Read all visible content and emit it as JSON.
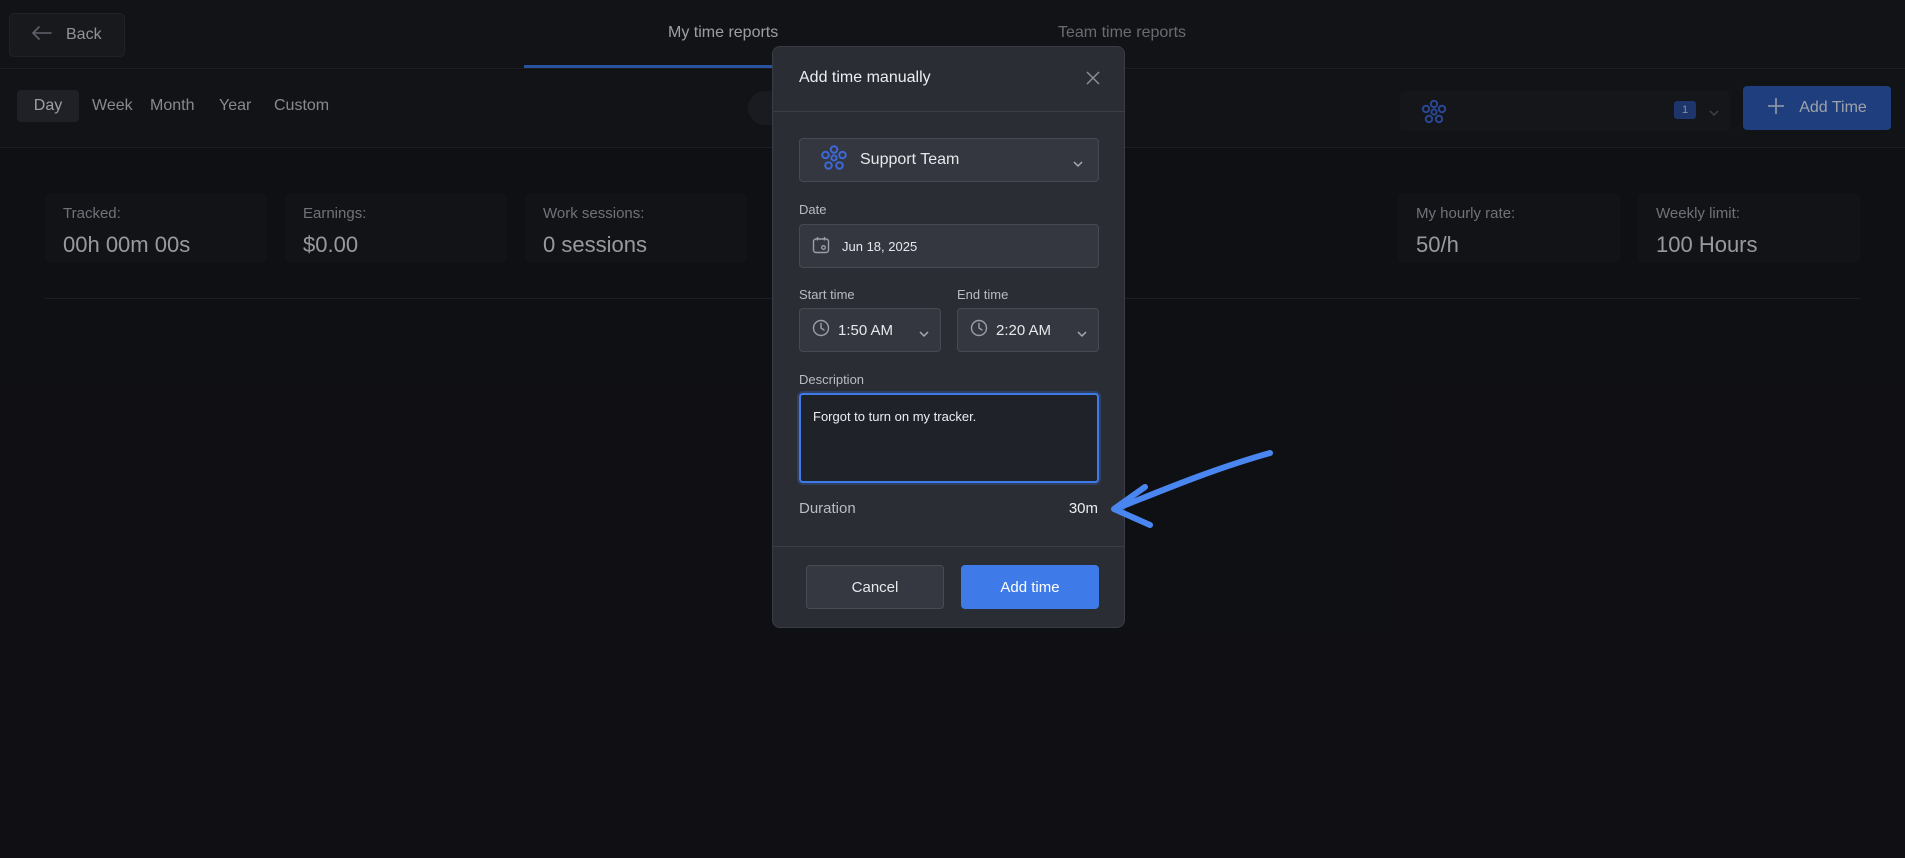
{
  "header": {
    "back_label": "Back",
    "tabs": [
      {
        "label": "My time reports",
        "active": true
      },
      {
        "label": "Team time reports",
        "active": false
      }
    ]
  },
  "toolbar": {
    "periods": [
      "Day",
      "Week",
      "Month",
      "Year",
      "Custom"
    ],
    "active_period": "Day",
    "team_badge_count": "1",
    "add_time_label": "Add Time"
  },
  "stats": [
    {
      "label": "Tracked:",
      "value": "00h 00m 00s"
    },
    {
      "label": "Earnings:",
      "value": "$0.00"
    },
    {
      "label": "Work sessions:",
      "value": "0 sessions"
    },
    {
      "label": "My hourly rate:",
      "value": "50/h"
    },
    {
      "label": "Weekly limit:",
      "value": "100 Hours"
    }
  ],
  "modal": {
    "title": "Add time manually",
    "team": "Support Team",
    "date_label": "Date",
    "date_value": "Jun 18, 2025",
    "start_label": "Start time",
    "start_value": "1:50 AM",
    "end_label": "End time",
    "end_value": "2:20 AM",
    "description_label": "Description",
    "description_value": "Forgot to turn on my tracker.",
    "duration_label": "Duration",
    "duration_value": "30m",
    "cancel_label": "Cancel",
    "submit_label": "Add time"
  },
  "colors": {
    "accent": "#3f7be8",
    "background": "#17181d",
    "modal_bg": "#2a2d34"
  }
}
